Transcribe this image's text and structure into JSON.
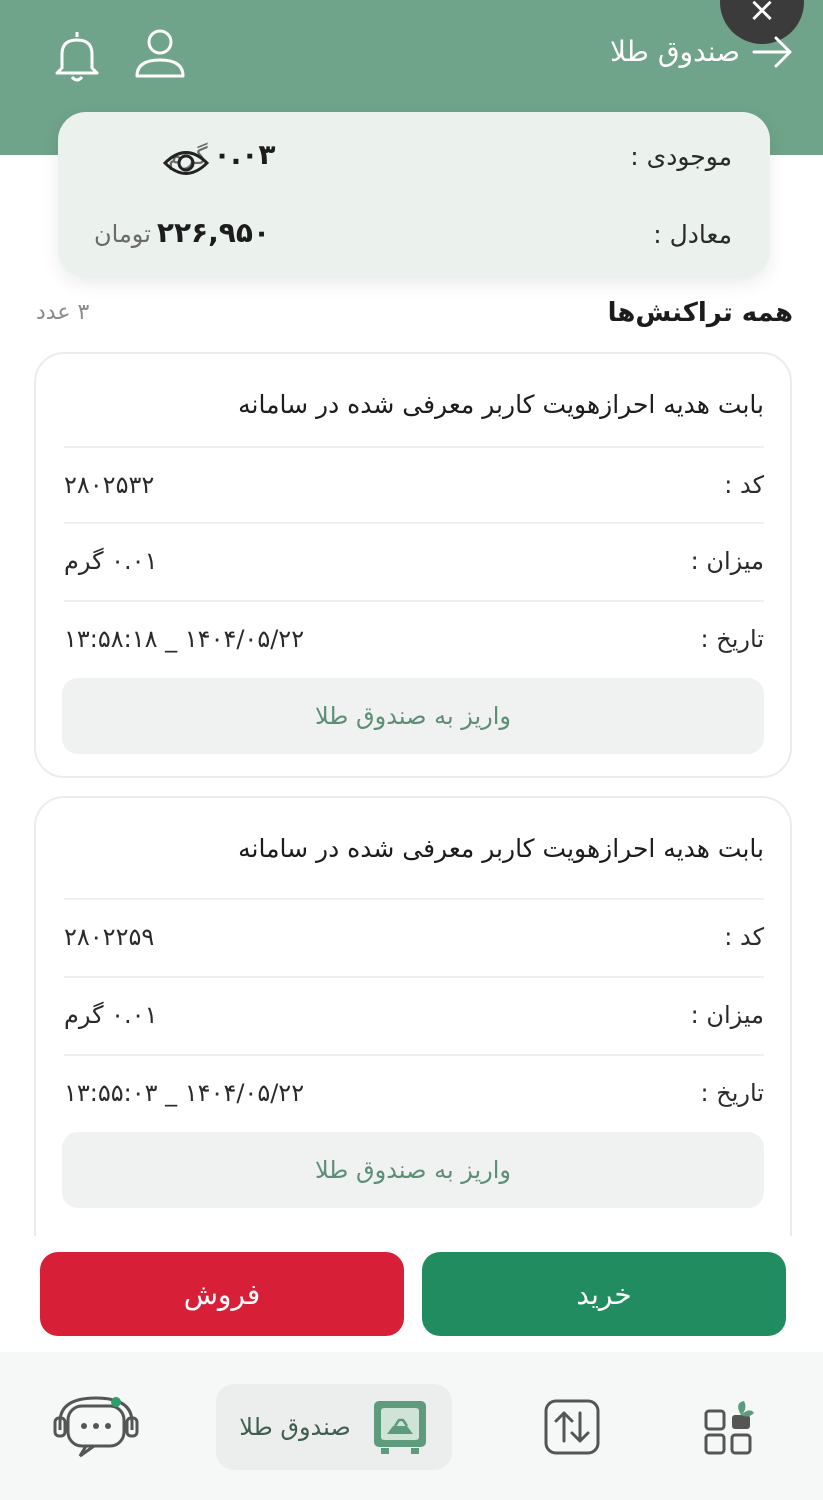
{
  "header": {
    "title": "صندوق طلا",
    "back_icon": "arrow-right-icon",
    "profile_icon": "user-icon",
    "notification_icon": "bell-icon",
    "close_label": "×"
  },
  "balance": {
    "stock_label": "موجودی :",
    "stock_value": "۰.۰۳",
    "stock_unit": "گرم",
    "equivalent_label": "معادل :",
    "equivalent_value": "۲۲۶,۹۵۰",
    "equivalent_unit": "تومان",
    "visibility_icon": "eye-icon"
  },
  "transactions": {
    "title": "همه تراکنش‌ها",
    "count": "۳ عدد",
    "items": [
      {
        "description": "بابت هدیه احرازهویت کاربر معرفی شده در سامانه",
        "code_label": "کد :",
        "code": "۲۸۰۲۵۳۲",
        "amount_label": "میزان :",
        "amount": "۰.۰۱ گرم",
        "date_label": "تاریخ :",
        "date": "۱۴۰۴/۰۵/۲۲ _ ۱۳:۵۸:۱۸",
        "status": "واریز به صندوق طلا"
      },
      {
        "description": "بابت هدیه احرازهویت کاربر معرفی شده در سامانه",
        "code_label": "کد :",
        "code": "۲۸۰۲۲۵۹",
        "amount_label": "میزان :",
        "amount": "۰.۰۱ گرم",
        "date_label": "تاریخ :",
        "date": "۱۴۰۴/۰۵/۲۲ _ ۱۳:۵۵:۰۳",
        "status": "واریز به صندوق طلا"
      }
    ]
  },
  "actions": {
    "buy_label": "خرید",
    "sell_label": "فروش",
    "buy_color": "#208c5f",
    "sell_color": "#d71f37"
  },
  "bottom_nav": {
    "support_icon": "support-chat-icon",
    "gold_box_label": "صندوق طلا",
    "gold_box_icon": "gold-safe-icon",
    "transfer_icon": "swap-arrows-icon",
    "services_icon": "grid-apps-icon"
  }
}
